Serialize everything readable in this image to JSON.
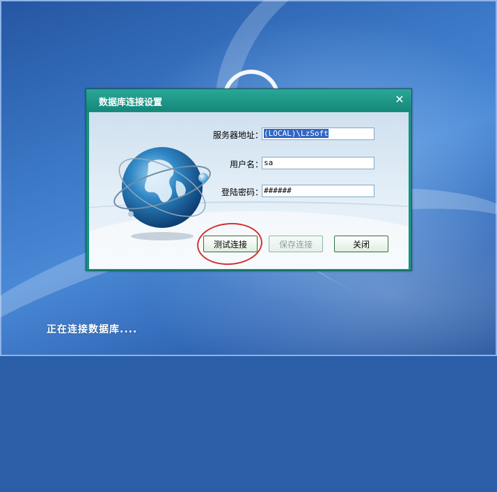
{
  "dialog": {
    "title": "数据库连接设置",
    "close_symbol": "✕",
    "fields": {
      "server": {
        "label": "服务器地址：",
        "value": "(LOCAL)\\LzSoft"
      },
      "username": {
        "label": "用户名：",
        "value": "sa"
      },
      "password": {
        "label": "登陆密码：",
        "value": "######"
      }
    },
    "buttons": {
      "test": "测试连接",
      "save": "保存连接",
      "close": "关闭"
    }
  },
  "status": {
    "text": "正在连接数据库...."
  },
  "colors": {
    "dialog_frame": "#1b8f82",
    "desktop": "#3b78c6",
    "annotation": "#d3312f"
  }
}
